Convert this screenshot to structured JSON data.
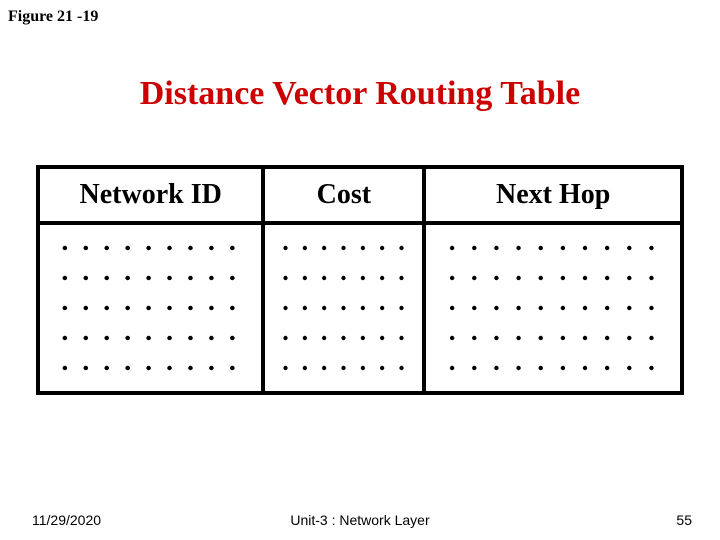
{
  "figure_label": "Figure 21 -19",
  "title": "Distance Vector Routing Table",
  "headers": {
    "network_id": "Network ID",
    "cost": "Cost",
    "next_hop": "Next Hop"
  },
  "footer": {
    "date": "11/29/2020",
    "unit": "Unit-3 : Network Layer",
    "page": "55"
  },
  "chart_data": {
    "type": "table",
    "title": "Distance Vector Routing Table",
    "columns": [
      "Network ID",
      "Cost",
      "Next Hop"
    ],
    "rows": [
      {
        "network_id": null,
        "cost": null,
        "next_hop": null
      },
      {
        "network_id": null,
        "cost": null,
        "next_hop": null
      },
      {
        "network_id": null,
        "cost": null,
        "next_hop": null
      },
      {
        "network_id": null,
        "cost": null,
        "next_hop": null
      },
      {
        "network_id": null,
        "cost": null,
        "next_hop": null
      }
    ],
    "note": "cells shown as placeholder dots; no explicit values in source"
  }
}
